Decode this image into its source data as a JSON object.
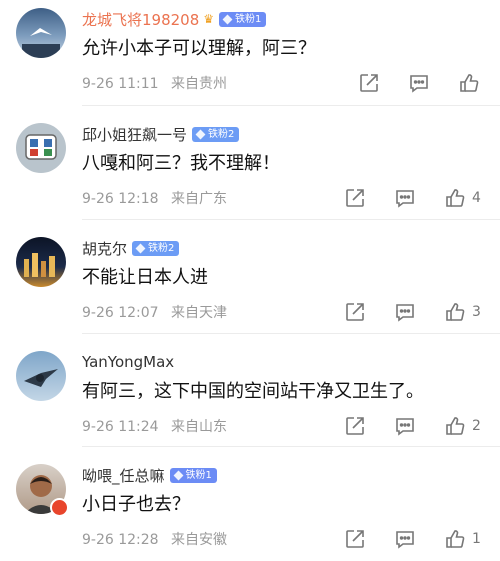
{
  "comments": [
    {
      "username": "龙城飞将198208",
      "badge": "铁粉1",
      "badge_color": "#6c8cf5",
      "vip": true,
      "text": "允许小本子可以理解，阿三？",
      "time": "9-26 11:11",
      "location": "来自贵州",
      "likes": ""
    },
    {
      "username": "邱小姐狂飙一号",
      "badge": "铁粉2",
      "badge_color": "#6c9cf5",
      "vip": false,
      "text": "八嘎和阿三？我不理解！",
      "time": "9-26 12:18",
      "location": "来自广东",
      "likes": "4"
    },
    {
      "username": "胡克尔",
      "badge": "铁粉2",
      "badge_color": "#6c9cf5",
      "vip": false,
      "text": "不能让日本人进",
      "time": "9-26 12:07",
      "location": "来自天津",
      "likes": "3"
    },
    {
      "username": "YanYongMax",
      "badge": "",
      "badge_color": "",
      "vip": false,
      "text": "有阿三，这下中国的空间站干净又卫生了。",
      "time": "9-26 11:24",
      "location": "来自山东",
      "likes": "2"
    },
    {
      "username": "呦喂_任总嘛",
      "badge": "铁粉1",
      "badge_color": "#6c8cf5",
      "vip": false,
      "text": "小日子也去？",
      "time": "9-26 12:28",
      "location": "来自安徽",
      "likes": "1"
    }
  ],
  "icons": {
    "share": "share-icon",
    "reply": "comment-icon",
    "like": "thumbs-up-icon"
  }
}
